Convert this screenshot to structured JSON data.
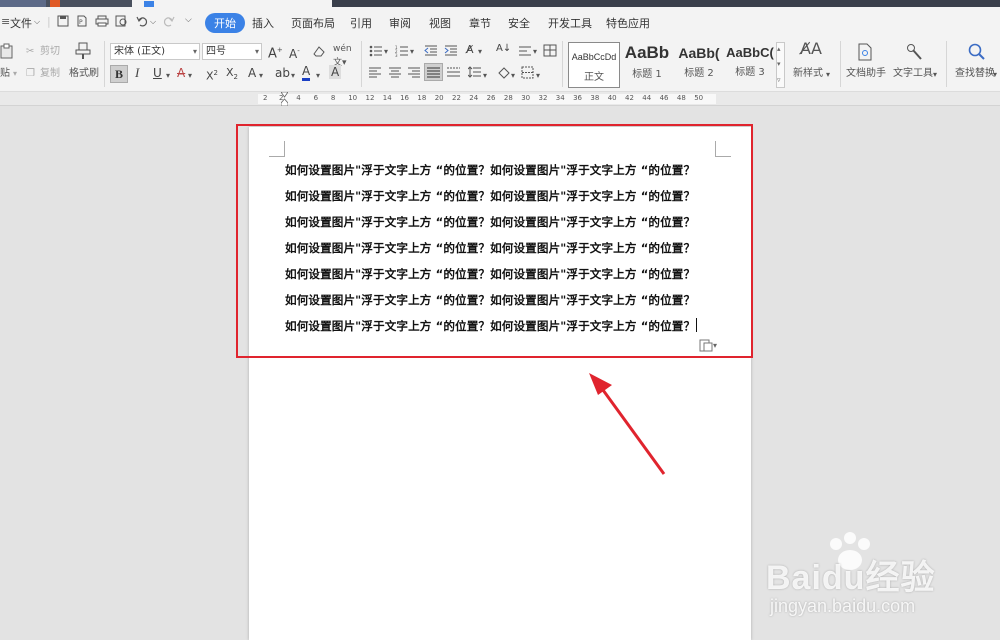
{
  "colors": {
    "accent": "#3b82e6",
    "highlight": "#e0242e",
    "arrow": "#e0242e"
  },
  "menubar": {
    "menu_icon": "≡",
    "file_label": "文件",
    "tabs": [
      "开始",
      "插入",
      "页面布局",
      "引用",
      "审阅",
      "视图",
      "章节",
      "安全",
      "开发工具",
      "特色应用"
    ],
    "active_tab": "开始"
  },
  "clipboard": {
    "paste_label": "贴",
    "cut_label": "剪切",
    "copy_label": "复制",
    "format_painter_label": "格式刷"
  },
  "font": {
    "name": "宋体 (正文)",
    "size": "四号"
  },
  "styles": [
    {
      "preview": "AaBbCcDd",
      "name": "正文"
    },
    {
      "preview": "AaBb",
      "name": "标题 1"
    },
    {
      "preview": "AaBb(",
      "name": "标题 2"
    },
    {
      "preview": "AaBbC(",
      "name": "标题 3"
    }
  ],
  "tools": {
    "new_style": "新样式",
    "doc_assistant": "文档助手",
    "text_tools": "文字工具",
    "find_replace": "查找替换"
  },
  "ruler": {
    "ticks": [
      "2",
      "2",
      "4",
      "6",
      "8",
      "10",
      "12",
      "14",
      "16",
      "18",
      "20",
      "22",
      "24",
      "26",
      "28",
      "30",
      "32",
      "34",
      "36",
      "38",
      "40",
      "42",
      "44",
      "46",
      "48",
      "50"
    ]
  },
  "document": {
    "lines": [
      "如何设置图片\"浮于文字上方 “的位置？如何设置图片\"浮于文字上方 “的位置？",
      "如何设置图片\"浮于文字上方 “的位置？如何设置图片\"浮于文字上方 “的位置？",
      "如何设置图片\"浮于文字上方 “的位置？如何设置图片\"浮于文字上方 “的位置？",
      "如何设置图片\"浮于文字上方 “的位置？如何设置图片\"浮于文字上方 “的位置？",
      "如何设置图片\"浮于文字上方 “的位置？如何设置图片\"浮于文字上方 “的位置？",
      "如何设置图片\"浮于文字上方 “的位置？如何设置图片\"浮于文字上方 “的位置？",
      "如何设置图片\"浮于文字上方 “的位置？如何设置图片\"浮于文字上方 “的位置？"
    ]
  },
  "watermark": {
    "brand": "Baidu经验",
    "site": "jingyan.baidu.com"
  }
}
